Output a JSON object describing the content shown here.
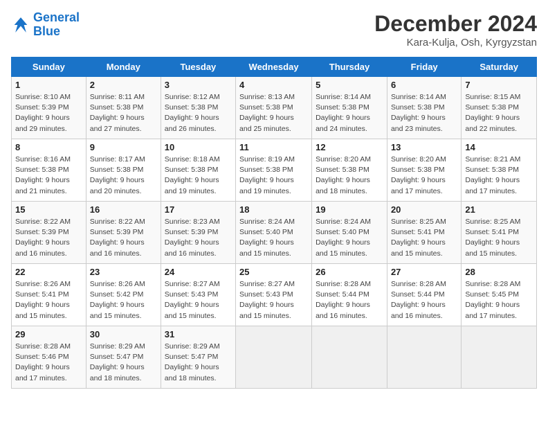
{
  "logo": {
    "line1": "General",
    "line2": "Blue"
  },
  "title": "December 2024",
  "location": "Kara-Kulja, Osh, Kyrgyzstan",
  "days_of_week": [
    "Sunday",
    "Monday",
    "Tuesday",
    "Wednesday",
    "Thursday",
    "Friday",
    "Saturday"
  ],
  "weeks": [
    [
      {
        "day": "1",
        "info": "Sunrise: 8:10 AM\nSunset: 5:39 PM\nDaylight: 9 hours\nand 29 minutes."
      },
      {
        "day": "2",
        "info": "Sunrise: 8:11 AM\nSunset: 5:38 PM\nDaylight: 9 hours\nand 27 minutes."
      },
      {
        "day": "3",
        "info": "Sunrise: 8:12 AM\nSunset: 5:38 PM\nDaylight: 9 hours\nand 26 minutes."
      },
      {
        "day": "4",
        "info": "Sunrise: 8:13 AM\nSunset: 5:38 PM\nDaylight: 9 hours\nand 25 minutes."
      },
      {
        "day": "5",
        "info": "Sunrise: 8:14 AM\nSunset: 5:38 PM\nDaylight: 9 hours\nand 24 minutes."
      },
      {
        "day": "6",
        "info": "Sunrise: 8:14 AM\nSunset: 5:38 PM\nDaylight: 9 hours\nand 23 minutes."
      },
      {
        "day": "7",
        "info": "Sunrise: 8:15 AM\nSunset: 5:38 PM\nDaylight: 9 hours\nand 22 minutes."
      }
    ],
    [
      {
        "day": "8",
        "info": "Sunrise: 8:16 AM\nSunset: 5:38 PM\nDaylight: 9 hours\nand 21 minutes."
      },
      {
        "day": "9",
        "info": "Sunrise: 8:17 AM\nSunset: 5:38 PM\nDaylight: 9 hours\nand 20 minutes."
      },
      {
        "day": "10",
        "info": "Sunrise: 8:18 AM\nSunset: 5:38 PM\nDaylight: 9 hours\nand 19 minutes."
      },
      {
        "day": "11",
        "info": "Sunrise: 8:19 AM\nSunset: 5:38 PM\nDaylight: 9 hours\nand 19 minutes."
      },
      {
        "day": "12",
        "info": "Sunrise: 8:20 AM\nSunset: 5:38 PM\nDaylight: 9 hours\nand 18 minutes."
      },
      {
        "day": "13",
        "info": "Sunrise: 8:20 AM\nSunset: 5:38 PM\nDaylight: 9 hours\nand 17 minutes."
      },
      {
        "day": "14",
        "info": "Sunrise: 8:21 AM\nSunset: 5:38 PM\nDaylight: 9 hours\nand 17 minutes."
      }
    ],
    [
      {
        "day": "15",
        "info": "Sunrise: 8:22 AM\nSunset: 5:39 PM\nDaylight: 9 hours\nand 16 minutes."
      },
      {
        "day": "16",
        "info": "Sunrise: 8:22 AM\nSunset: 5:39 PM\nDaylight: 9 hours\nand 16 minutes."
      },
      {
        "day": "17",
        "info": "Sunrise: 8:23 AM\nSunset: 5:39 PM\nDaylight: 9 hours\nand 16 minutes."
      },
      {
        "day": "18",
        "info": "Sunrise: 8:24 AM\nSunset: 5:40 PM\nDaylight: 9 hours\nand 15 minutes."
      },
      {
        "day": "19",
        "info": "Sunrise: 8:24 AM\nSunset: 5:40 PM\nDaylight: 9 hours\nand 15 minutes."
      },
      {
        "day": "20",
        "info": "Sunrise: 8:25 AM\nSunset: 5:41 PM\nDaylight: 9 hours\nand 15 minutes."
      },
      {
        "day": "21",
        "info": "Sunrise: 8:25 AM\nSunset: 5:41 PM\nDaylight: 9 hours\nand 15 minutes."
      }
    ],
    [
      {
        "day": "22",
        "info": "Sunrise: 8:26 AM\nSunset: 5:41 PM\nDaylight: 9 hours\nand 15 minutes."
      },
      {
        "day": "23",
        "info": "Sunrise: 8:26 AM\nSunset: 5:42 PM\nDaylight: 9 hours\nand 15 minutes."
      },
      {
        "day": "24",
        "info": "Sunrise: 8:27 AM\nSunset: 5:43 PM\nDaylight: 9 hours\nand 15 minutes."
      },
      {
        "day": "25",
        "info": "Sunrise: 8:27 AM\nSunset: 5:43 PM\nDaylight: 9 hours\nand 15 minutes."
      },
      {
        "day": "26",
        "info": "Sunrise: 8:28 AM\nSunset: 5:44 PM\nDaylight: 9 hours\nand 16 minutes."
      },
      {
        "day": "27",
        "info": "Sunrise: 8:28 AM\nSunset: 5:44 PM\nDaylight: 9 hours\nand 16 minutes."
      },
      {
        "day": "28",
        "info": "Sunrise: 8:28 AM\nSunset: 5:45 PM\nDaylight: 9 hours\nand 17 minutes."
      }
    ],
    [
      {
        "day": "29",
        "info": "Sunrise: 8:28 AM\nSunset: 5:46 PM\nDaylight: 9 hours\nand 17 minutes."
      },
      {
        "day": "30",
        "info": "Sunrise: 8:29 AM\nSunset: 5:47 PM\nDaylight: 9 hours\nand 18 minutes."
      },
      {
        "day": "31",
        "info": "Sunrise: 8:29 AM\nSunset: 5:47 PM\nDaylight: 9 hours\nand 18 minutes."
      },
      null,
      null,
      null,
      null
    ]
  ]
}
